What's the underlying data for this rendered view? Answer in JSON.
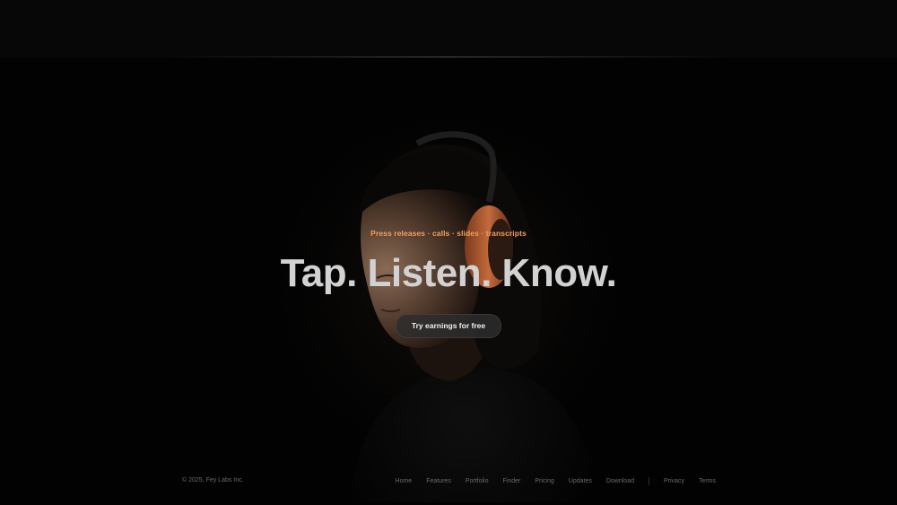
{
  "hero": {
    "eyebrow": "Press releases · calls · slides · transcripts",
    "headline": "Tap. Listen. Know.",
    "cta_label": "Try earnings for free"
  },
  "footer": {
    "copyright": "© 2025, Fey Labs Inc.",
    "nav": [
      "Home",
      "Features",
      "Portfolio",
      "Finder",
      "Pricing",
      "Updates",
      "Download"
    ],
    "legal": [
      "Privacy",
      "Terms"
    ]
  },
  "colors": {
    "background": "#020202",
    "accent": "#f0a060",
    "headline": "#d2d2d2",
    "headphone": "#c46a3c"
  }
}
